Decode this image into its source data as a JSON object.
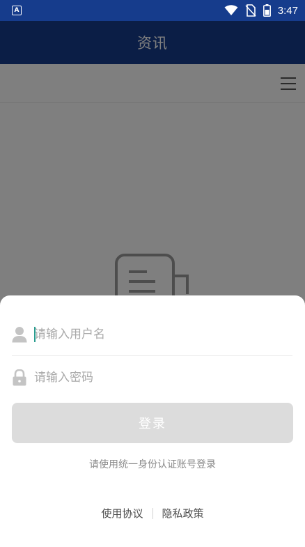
{
  "status_bar": {
    "app_indicator": "A",
    "time": "3:47",
    "icons": [
      "wifi-icon",
      "no-sim-icon",
      "battery-icon"
    ]
  },
  "header": {
    "title": "资讯"
  },
  "toolbar": {
    "menu_icon": "hamburger-menu-icon"
  },
  "content": {
    "empty_state_icon": "document-icon"
  },
  "login": {
    "username_placeholder": "请输入用户名",
    "password_placeholder": "请输入密码",
    "login_button": "登录",
    "hint": "请使用统一身份认证账号登录",
    "terms_link": "使用协议",
    "privacy_link": "隐私政策"
  },
  "colors": {
    "header_bg": "#163c8c",
    "button_bg": "#dcdcdc",
    "cursor": "#2a9d8f"
  }
}
